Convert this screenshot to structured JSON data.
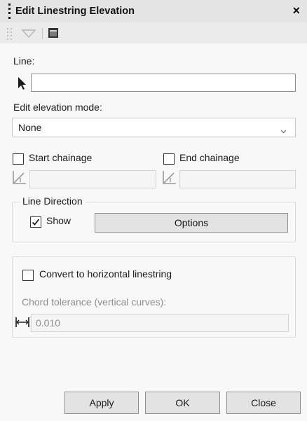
{
  "window": {
    "title": "Edit Linestring Elevation",
    "close_glyph": "×"
  },
  "toolbar": {
    "icons": [
      "grip-dots-icon",
      "filter-funnel-icon",
      "panel-icon"
    ]
  },
  "line_field": {
    "label": "Line:",
    "value": "",
    "icon": "pointer-arrow-icon"
  },
  "elevation_mode": {
    "label": "Edit elevation mode:",
    "selected": "None",
    "chevron": "⌄"
  },
  "start_chainage": {
    "label": "Start chainage",
    "checked": false,
    "value": "",
    "icon": "chainage-slope-icon"
  },
  "end_chainage": {
    "label": "End chainage",
    "checked": false,
    "value": "",
    "icon": "chainage-slope-icon"
  },
  "line_direction": {
    "legend": "Line Direction",
    "show_label": "Show",
    "show_checked": true,
    "options_button": "Options"
  },
  "convert": {
    "label": "Convert to horizontal linestring",
    "checked": false,
    "tolerance_label": "Chord tolerance (vertical curves):",
    "tolerance_value": "0.010",
    "icon": "horizontal-width-icon"
  },
  "buttons": {
    "apply": "Apply",
    "ok": "OK",
    "close": "Close"
  },
  "colors": {
    "titlebar": "#e4e4e4",
    "background": "#f8f8f8",
    "button_face": "#e3e3e3",
    "disabled_text": "#8f8f8f"
  }
}
